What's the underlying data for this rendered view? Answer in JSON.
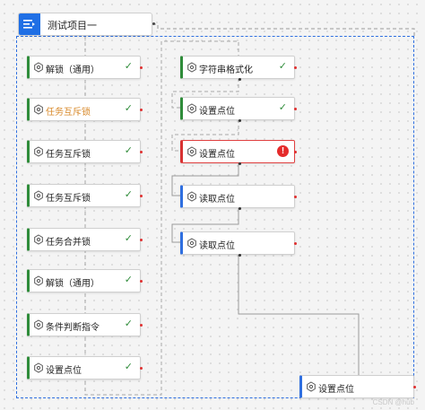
{
  "root": {
    "title": "测试项目一",
    "icon": "workflow-list-icon"
  },
  "left_column": [
    {
      "label": "解锁（通用）",
      "status": "done"
    },
    {
      "label": "任务互斥锁",
      "status": "done",
      "highlight_color": "#d8892a"
    },
    {
      "label": "任务互斥锁",
      "status": "done"
    },
    {
      "label": "任务互斥锁",
      "status": "done"
    },
    {
      "label": "任务合并锁",
      "status": "done"
    },
    {
      "label": "解锁（通用）",
      "status": "done"
    },
    {
      "label": "条件判断指令",
      "status": "done"
    },
    {
      "label": "设置点位",
      "status": "done"
    }
  ],
  "right_column": [
    {
      "label": "字符串格式化",
      "status": "done"
    },
    {
      "label": "设置点位",
      "status": "done"
    },
    {
      "label": "设置点位",
      "status": "error"
    },
    {
      "label": "读取点位",
      "status": "idle"
    },
    {
      "label": "读取点位",
      "status": "idle"
    }
  ],
  "final_node": {
    "label": "设置点位",
    "status": "idle"
  },
  "status_icons": {
    "done": "checkmark-icon",
    "error": "error-icon",
    "node": "gear-icon"
  },
  "colors": {
    "done": "#2f8c3a",
    "error": "#e52b2b",
    "accent": "#1f6fe5",
    "highlight": "#d8892a"
  },
  "watermark": "CSDN @hub"
}
